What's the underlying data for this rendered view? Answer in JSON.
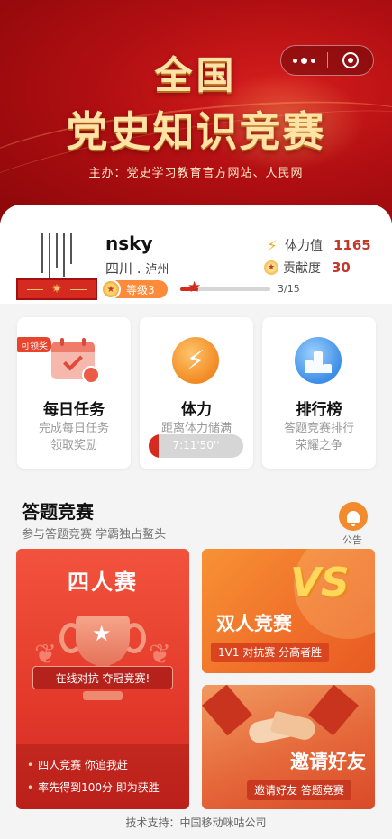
{
  "header": {
    "title_line1": "全国",
    "title_line2": "党史知识竞赛",
    "organizer": "主办：党史学习教育官方网站、人民网",
    "capsule_more_icon": "more-dots-icon",
    "capsule_close_icon": "target-ring-icon"
  },
  "profile": {
    "username": "nsky",
    "province": "四川",
    "dot": ".",
    "city": "泸州",
    "level_label": "等级3",
    "progress_text": "3/15",
    "progress_value": 0.2,
    "stamina_label": "体力值",
    "stamina_value": "1165",
    "contribution_label": "贡献度",
    "contribution_value": "30"
  },
  "features": {
    "daily": {
      "tag": "可领奖",
      "title": "每日任务",
      "sub1": "完成每日任务",
      "sub2": "领取奖励"
    },
    "stamina": {
      "title": "体力",
      "sub1": "距离体力储满",
      "timer": "7:11'50''",
      "fill": 0.1
    },
    "rank": {
      "title": "排行榜",
      "sub1": "答题竞赛排行",
      "sub2": "荣耀之争"
    }
  },
  "quiz": {
    "section_title": "答题竞赛",
    "section_sub": "参与答题竞赛 学霸独占鳌头",
    "notice_label": "公告",
    "four": {
      "title": "四人赛",
      "slogan": "在线对抗 夺冠竞赛!",
      "line1": "四人竞赛 你追我赶",
      "line2": "率先得到100分 即为获胜"
    },
    "duo": {
      "vs_text": "VS",
      "title": "双人竞赛",
      "sub": "1V1 对抗赛 分高者胜"
    },
    "invite": {
      "title": "邀请好友",
      "sub": "邀请好友 答题竞赛"
    }
  },
  "footer": {
    "text": "技术支持：中国移动咪咕公司"
  },
  "colors": {
    "primary_red": "#d42a1f",
    "accent_orange": "#f28a2e",
    "gold": "#ffe3a6"
  }
}
